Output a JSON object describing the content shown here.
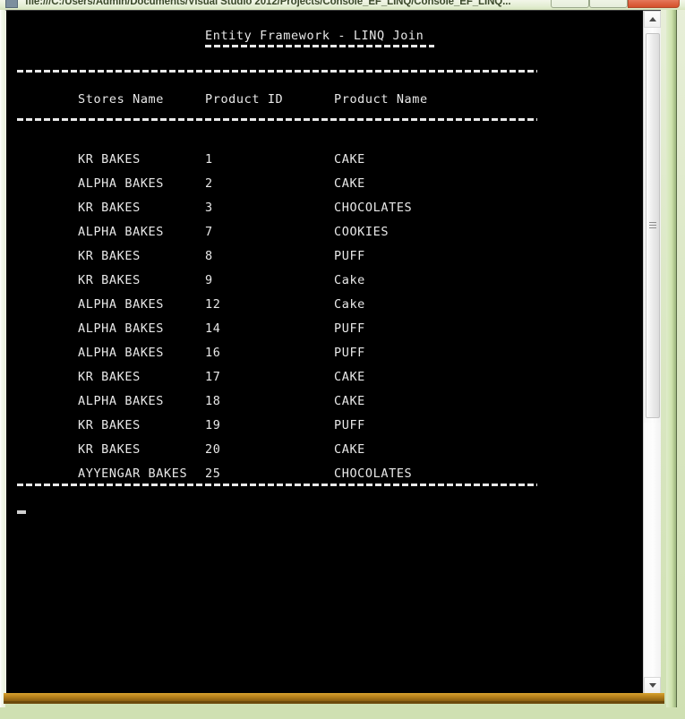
{
  "window": {
    "title": "file:///C:/Users/Admin/Documents/Visual Studio 2012/Projects/Console_EF_LINQ/Console_EF_LINQ...",
    "minimize_label": "",
    "maximize_label": "",
    "close_label": "",
    "frame_color": "#cfe0b2",
    "bottom_border_color": "#b8821c"
  },
  "console": {
    "background_color": "#000000",
    "text_color": "#e8e8e8",
    "title": "Entity Framework - LINQ Join",
    "columns": {
      "stores_name": "Stores Name",
      "product_id": "Product ID",
      "product_name": "Product Name"
    },
    "rows": [
      {
        "store": "KR BAKES",
        "id": "1",
        "product": "CAKE"
      },
      {
        "store": "ALPHA BAKES",
        "id": "2",
        "product": "CAKE"
      },
      {
        "store": "KR BAKES",
        "id": "3",
        "product": "CHOCOLATES"
      },
      {
        "store": "ALPHA BAKES",
        "id": "7",
        "product": "COOKIES"
      },
      {
        "store": "KR BAKES",
        "id": "8",
        "product": "PUFF"
      },
      {
        "store": "KR BAKES",
        "id": "9",
        "product": "Cake"
      },
      {
        "store": "ALPHA BAKES",
        "id": "12",
        "product": "Cake"
      },
      {
        "store": "ALPHA BAKES",
        "id": "14",
        "product": "PUFF"
      },
      {
        "store": "ALPHA BAKES",
        "id": "16",
        "product": "PUFF"
      },
      {
        "store": "KR BAKES",
        "id": "17",
        "product": "CAKE"
      },
      {
        "store": "ALPHA BAKES",
        "id": "18",
        "product": "CAKE"
      },
      {
        "store": "KR BAKES",
        "id": "19",
        "product": "PUFF"
      },
      {
        "store": "KR BAKES",
        "id": "20",
        "product": "CAKE"
      },
      {
        "store": "AYYENGAR BAKES",
        "id": "25",
        "product": "CHOCOLATES"
      }
    ],
    "cursor": "_"
  },
  "scrollbar": {
    "up_arrow": "▲",
    "down_arrow": "▼"
  }
}
